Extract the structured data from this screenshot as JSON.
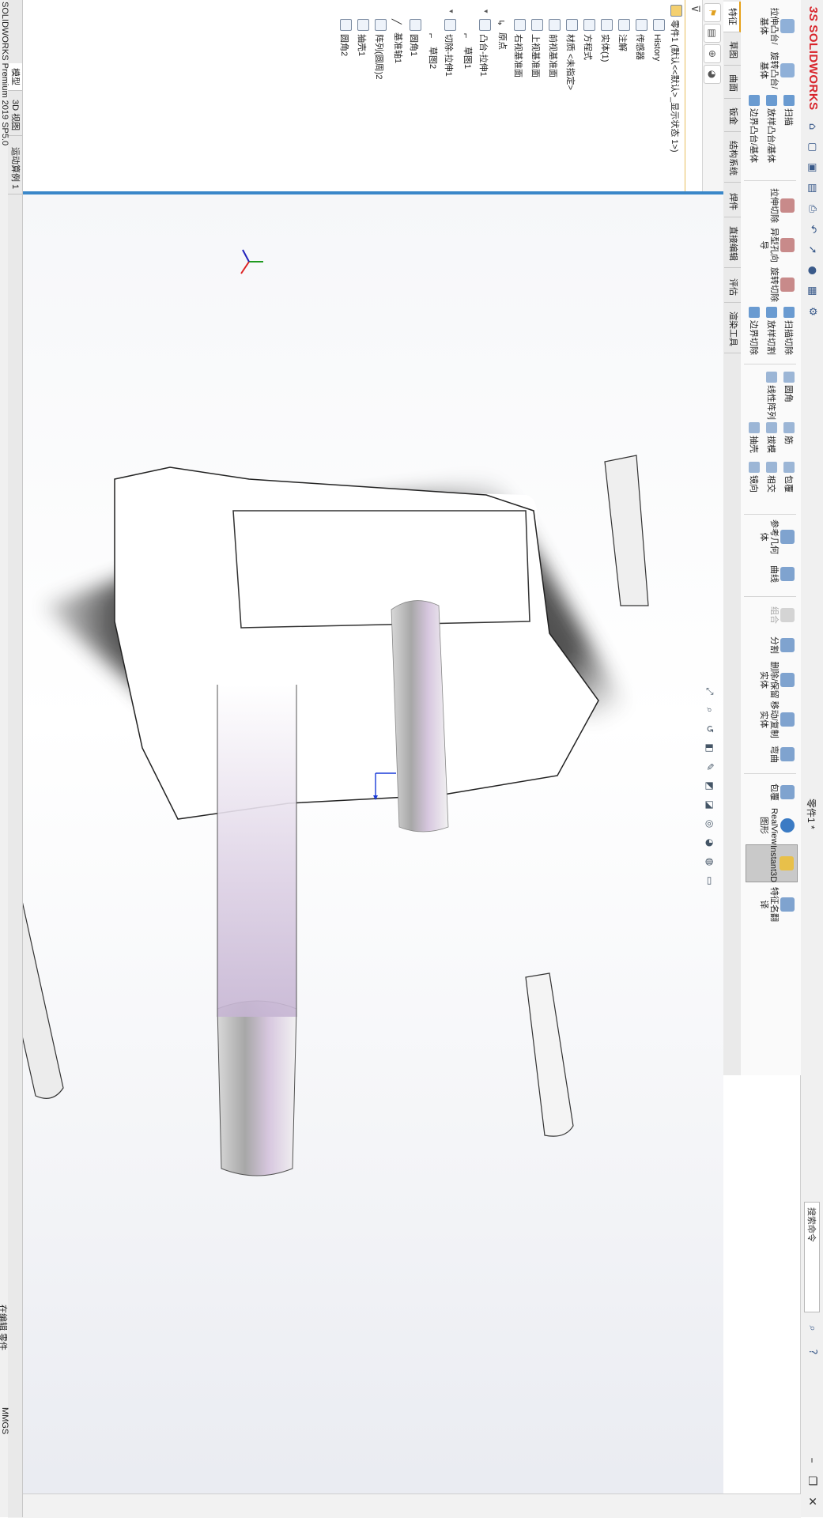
{
  "app": {
    "brand": "SOLIDWORKS",
    "brand_prefix": "3S",
    "document_title": "零件1 *",
    "search_placeholder": "搜索命令",
    "accent_color": "#d8232a"
  },
  "command_manager": {
    "group1": [
      "拉伸凸台/基体",
      "旋转凸台/基体"
    ],
    "group1_small": [
      "扫描",
      "放样凸台/基体",
      "边界凸台/基体"
    ],
    "group2": [
      "拉伸切除",
      "异型孔向导",
      "旋转切除"
    ],
    "group2_small": [
      "扫描切除",
      "放样切割",
      "边界切除"
    ],
    "group3_small": [
      "圆角",
      "线性阵列",
      "筋",
      "拔模",
      "包覆",
      "抽壳",
      "相交",
      "镜向"
    ],
    "group4": [
      "参考几何体",
      "曲线"
    ],
    "group5": [
      "组合",
      "分割",
      "删除/保留实体",
      "移动/复制实体",
      "弯曲"
    ],
    "group6": [
      "包覆",
      "RealView图形",
      "Instant3D",
      "特征名翻译"
    ]
  },
  "tabs": [
    "特征",
    "草图",
    "曲面",
    "钣金",
    "结构系统",
    "焊件",
    "直接编辑",
    "评估",
    "渲染工具"
  ],
  "feature_tree": {
    "root": "零件1 (默认<<默认>_显示状态 1>)",
    "items": [
      {
        "label": "History",
        "indent": 1
      },
      {
        "label": "传感器",
        "indent": 1
      },
      {
        "label": "注解",
        "indent": 1
      },
      {
        "label": "实体(1)",
        "indent": 1
      },
      {
        "label": "方程式",
        "indent": 1
      },
      {
        "label": "材质 <未指定>",
        "indent": 1
      },
      {
        "label": "前视基准面",
        "indent": 1
      },
      {
        "label": "上视基准面",
        "indent": 1
      },
      {
        "label": "右视基准面",
        "indent": 1
      },
      {
        "label": "原点",
        "indent": 1
      },
      {
        "label": "凸台-拉伸1",
        "indent": 1
      },
      {
        "label": "草图1",
        "indent": 2
      },
      {
        "label": "切除-拉伸1",
        "indent": 1
      },
      {
        "label": "草图2",
        "indent": 2
      },
      {
        "label": "圆角1",
        "indent": 1
      },
      {
        "label": "基准轴1",
        "indent": 1
      },
      {
        "label": "阵列(圆周)2",
        "indent": 1
      },
      {
        "label": "抽壳1",
        "indent": 1
      },
      {
        "label": "圆角2",
        "indent": 1
      }
    ]
  },
  "bottom_tabs": [
    "模型",
    "3D 视图",
    "运动算例 1"
  ],
  "status": {
    "left": "SOLIDWORKS Premium 2019 SP5.0",
    "editing": "在编辑 零件",
    "units": "MMGS"
  },
  "icons": {
    "filter": "filter-icon",
    "triad": "view-triad-icon"
  }
}
